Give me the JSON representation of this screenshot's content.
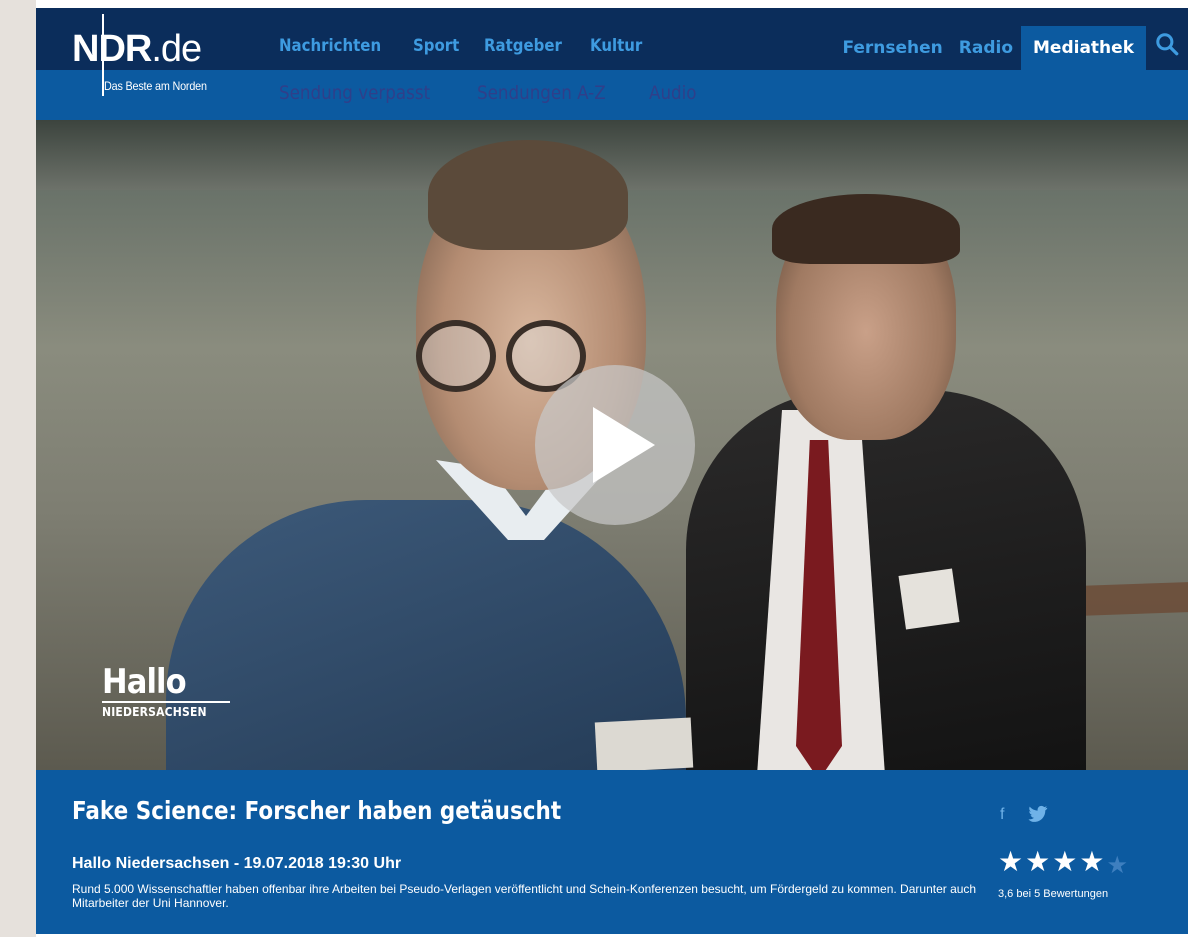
{
  "header": {
    "logo": {
      "brand": "NDR",
      "domain": ".de",
      "tagline": "Das Beste am Norden"
    },
    "nav_main": [
      "Nachrichten",
      "Sport",
      "Ratgeber",
      "Kultur"
    ],
    "nav_right": [
      "Fernsehen",
      "Radio",
      "Mediathek"
    ],
    "nav_sub": [
      "Sendung verpasst",
      "Sendungen A-Z",
      "Audio"
    ],
    "search_icon": "search-icon"
  },
  "video": {
    "show_logo_big": "Hallo",
    "show_logo_small": "NIEDERSACHSEN",
    "play_icon": "play-icon"
  },
  "info": {
    "title": "Fake Science: Forscher haben getäuscht",
    "subtitle": "Hallo Niedersachsen - 19.07.2018 19:30 Uhr",
    "description": "Rund 5.000 Wissenschaftler haben offenbar ihre Arbeiten bei Pseudo-Verlagen veröffentlicht und Schein-Konferenzen besucht, um Fördergeld zu kommen. Darunter auch Mitarbeiter der Uni Hannover.",
    "social": {
      "facebook": "f",
      "twitter_icon": "twitter-icon"
    },
    "rating": {
      "value": 3.6,
      "max": 5,
      "text": "3,6 bei 5 Bewertungen"
    }
  },
  "colors": {
    "topbar": "#0b2d5b",
    "subbar": "#0c5aa0",
    "nav_link": "#3e9be0",
    "sub_link": "#2f3f8a"
  }
}
